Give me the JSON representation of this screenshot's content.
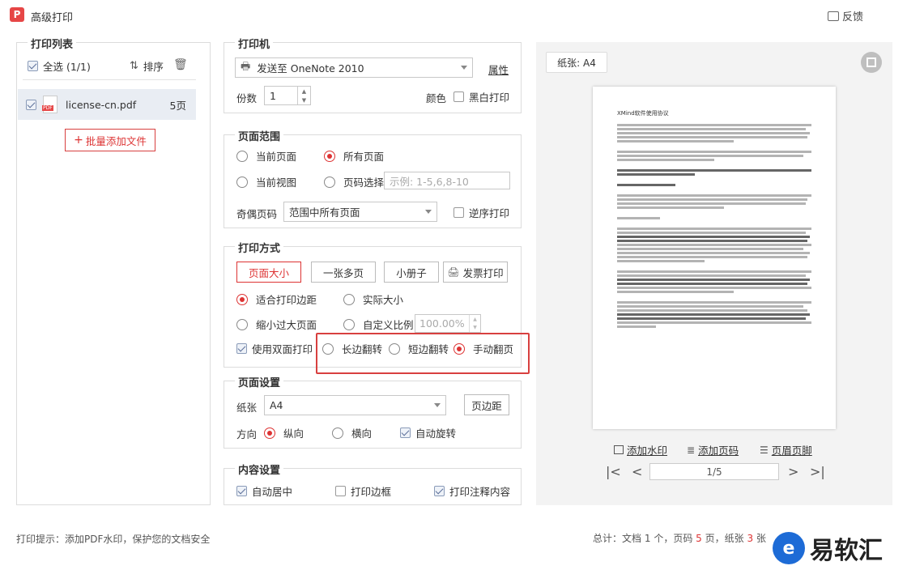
{
  "window": {
    "title": "高级打印",
    "feedback": "反馈",
    "logo_letter": "P"
  },
  "print_list": {
    "title": "打印列表",
    "select_all": "全选 (1/1)",
    "sort": "排序",
    "files": [
      {
        "name": "license-cn.pdf",
        "pages": "5页",
        "checked": true,
        "type_badge": "PDF"
      }
    ],
    "add_files": "批量添加文件"
  },
  "printer": {
    "title": "打印机",
    "selected": "发送至 OneNote 2010",
    "properties": "属性",
    "copies_label": "份数",
    "copies": "1",
    "color_label": "颜色",
    "bw_print": "黑白打印"
  },
  "page_range": {
    "title": "页面范围",
    "current_page": "当前页面",
    "all_pages": "所有页面",
    "current_view": "当前视图",
    "page_select": "页码选择",
    "page_select_placeholder": "示例: 1-5,6,8-10",
    "odd_even_label": "奇偶页码",
    "odd_even_value": "范围中所有页面",
    "reverse": "逆序打印"
  },
  "print_mode": {
    "title": "打印方式",
    "tabs": [
      "页面大小",
      "一张多页",
      "小册子",
      "发票打印"
    ],
    "fit_margin": "适合打印边距",
    "actual_size": "实际大小",
    "shrink": "缩小过大页面",
    "custom_scale": "自定义比例",
    "scale_value": "100.00%",
    "duplex": "使用双面打印",
    "long_edge": "长边翻转",
    "short_edge": "短边翻转",
    "manual": "手动翻页"
  },
  "page_setup": {
    "title": "页面设置",
    "paper_label": "纸张",
    "paper_value": "A4",
    "margins": "页边距",
    "orientation_label": "方向",
    "portrait": "纵向",
    "landscape": "横向",
    "auto_rotate": "自动旋转"
  },
  "content_setup": {
    "title": "内容设置",
    "auto_center": "自动居中",
    "print_border": "打印边框",
    "print_annotations": "打印注释内容"
  },
  "preview": {
    "paper_tag": "纸张: A4",
    "doc_title": "XMind软件使用协议",
    "add_watermark": "添加水印",
    "add_page_number": "添加页码",
    "header_footer": "页眉页脚",
    "page_indicator": "1/5"
  },
  "footer": {
    "tip": "打印提示：添加PDF水印，保护您的文档安全",
    "summary_prefix": "总计：文档",
    "docs": "1",
    "mid1": "个，页码",
    "pages": "5",
    "mid2": "页，纸张",
    "sheets": "3",
    "suffix": "张"
  },
  "brand": {
    "logo": "e",
    "text": "易软汇"
  }
}
